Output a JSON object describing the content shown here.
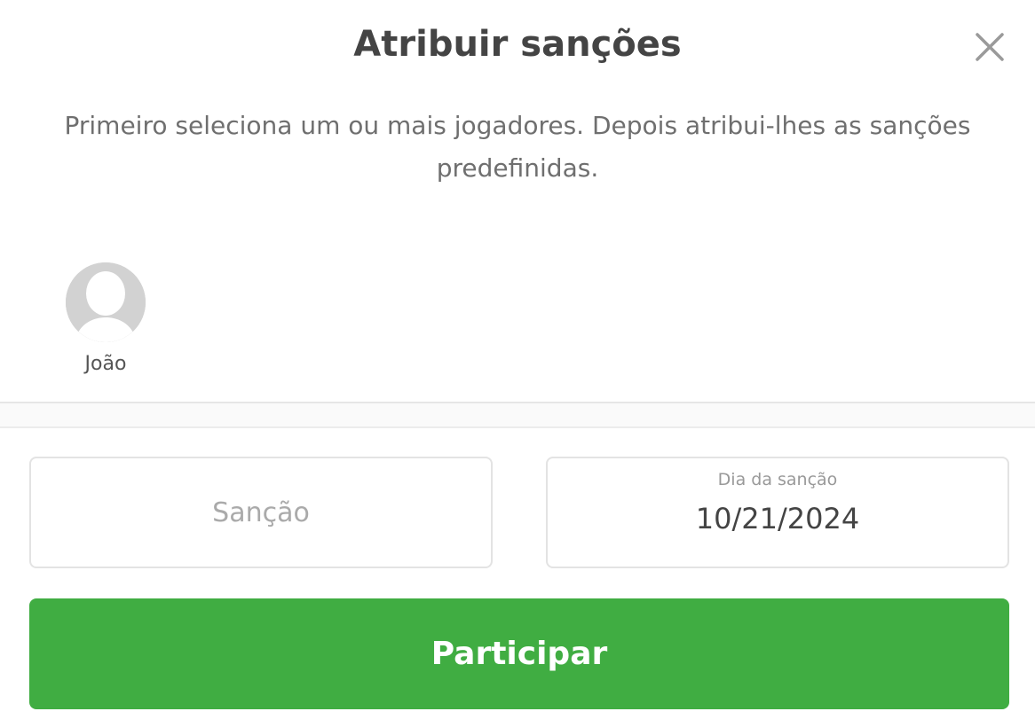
{
  "modal": {
    "title": "Atribuir sanções",
    "close_icon": "close-icon",
    "description": "Primeiro seleciona um ou mais jogadores. Depois atribui-lhes as sanções predefinidas."
  },
  "players": [
    {
      "name": "João",
      "avatar_icon": "default-avatar-icon"
    }
  ],
  "form": {
    "sanction": {
      "placeholder": "Sanção",
      "value": ""
    },
    "date": {
      "label": "Dia da sanção",
      "value": "10/21/2024"
    }
  },
  "submit": {
    "label": "Participar"
  },
  "colors": {
    "accent": "#40ad42",
    "avatar_bg": "#d2d2d2",
    "text": "#444444",
    "muted_text": "#6f6f6f",
    "border": "#e3e3e3"
  }
}
